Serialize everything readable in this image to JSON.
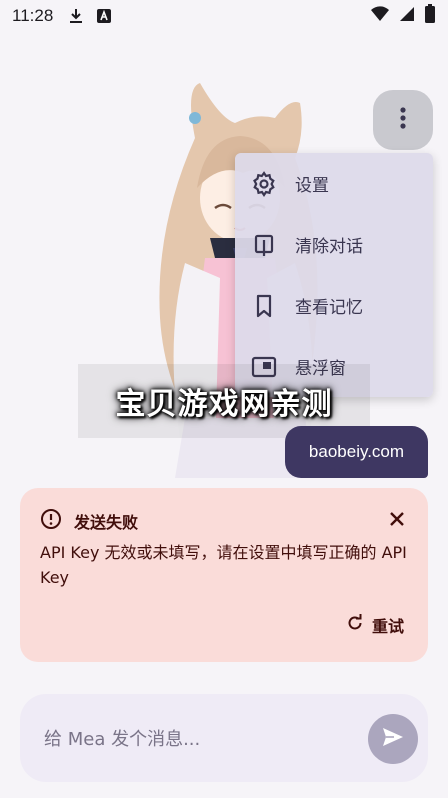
{
  "status_bar": {
    "time": "11:28",
    "icons": [
      "download-icon",
      "a-letter-icon",
      "wifi-icon",
      "signal-icon",
      "battery-icon"
    ]
  },
  "menu": {
    "button_icon": "more-vert-icon",
    "items": [
      {
        "label": "设置",
        "icon": "gear-icon"
      },
      {
        "label": "清除对话",
        "icon": "clear-chat-icon"
      },
      {
        "label": "查看记忆",
        "icon": "bookmark-icon"
      },
      {
        "label": "悬浮窗",
        "icon": "floating-window-icon"
      }
    ]
  },
  "watermark": {
    "text": "宝贝游戏网亲测"
  },
  "site_label": {
    "text": "baobeiy.com"
  },
  "error": {
    "title": "发送失败",
    "message": "API Key 无效或未填写，请在设置中填写正确的 API Key",
    "retry_label": "重试"
  },
  "composer": {
    "placeholder": "给 Mea 发个消息..."
  },
  "colors": {
    "menu_bg": "#dddaea",
    "pill_bg": "#3e3762",
    "error_bg": "#fadcd9",
    "error_text": "#410e0b",
    "send_bg": "#aba6be"
  }
}
